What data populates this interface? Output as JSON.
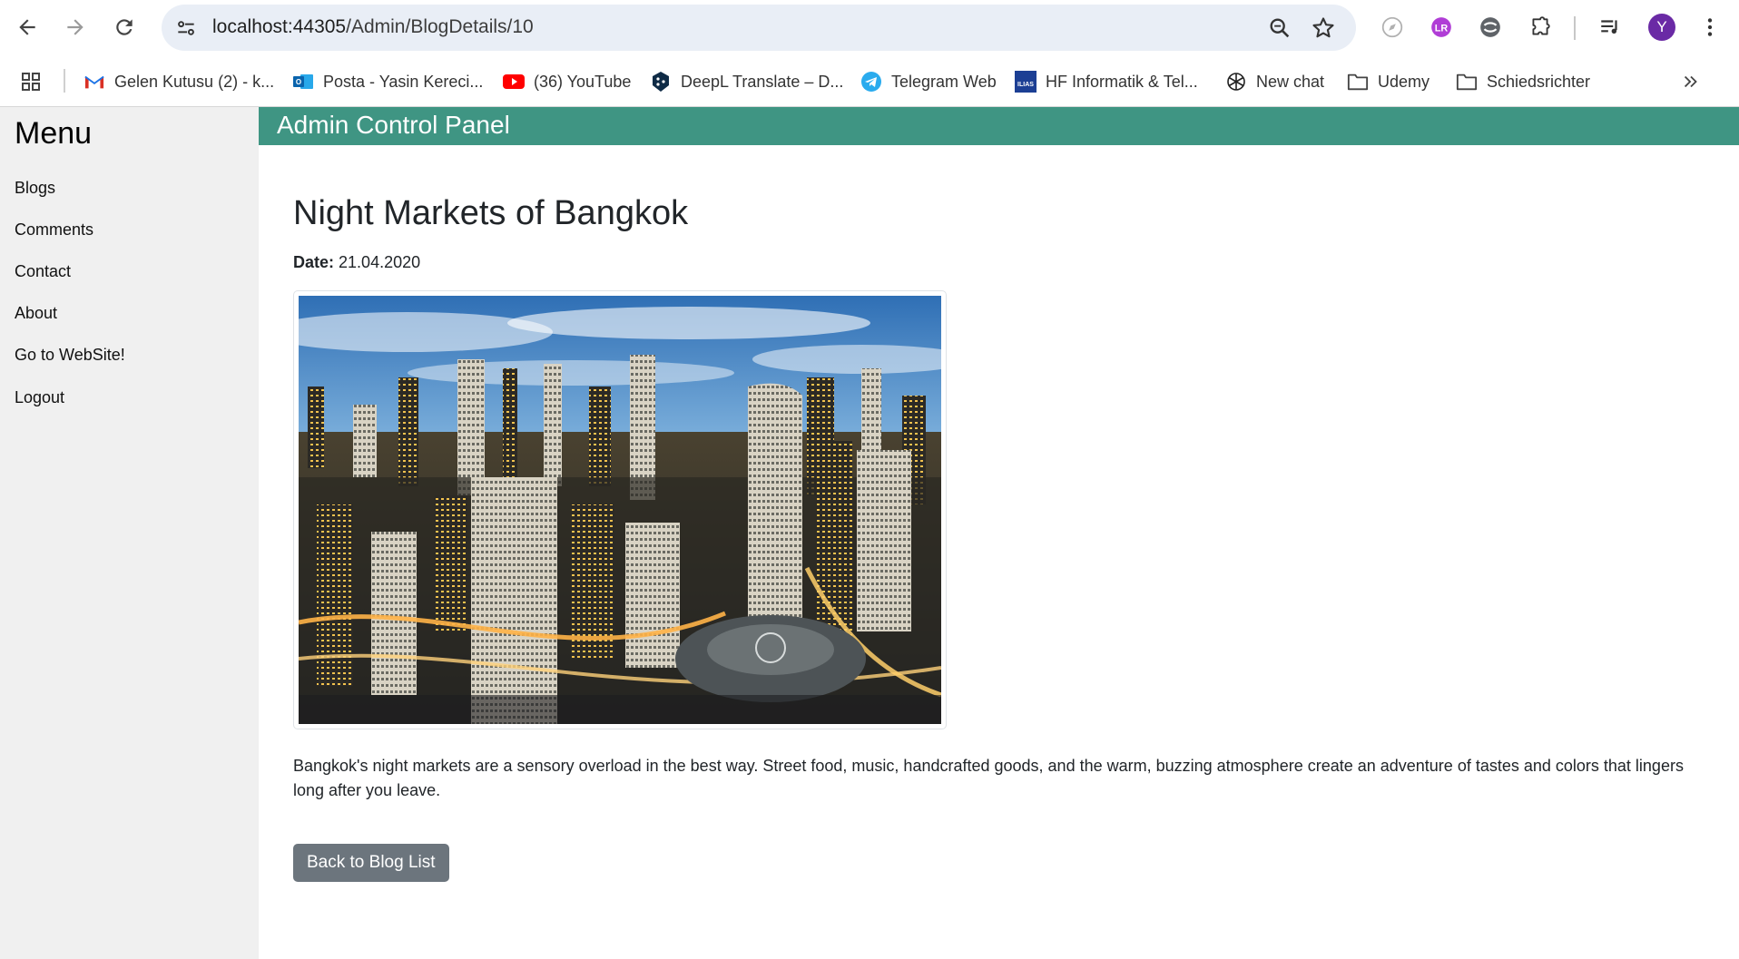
{
  "browser": {
    "url_host": "localhost:44305",
    "url_path": "/Admin/BlogDetails/10",
    "avatar_letter": "Y",
    "bookmarks": [
      {
        "label": "Gelen Kutusu (2) - k...",
        "icon": "gmail-icon"
      },
      {
        "label": "Posta - Yasin Kereci...",
        "icon": "outlook-icon"
      },
      {
        "label": "(36) YouTube",
        "icon": "youtube-icon"
      },
      {
        "label": "DeepL Translate – D...",
        "icon": "deepl-icon"
      },
      {
        "label": "Telegram Web",
        "icon": "telegram-icon"
      },
      {
        "label": "HF Informatik & Tel...",
        "icon": "ilias-icon"
      },
      {
        "label": "New chat",
        "icon": "openai-icon"
      },
      {
        "label": "Udemy",
        "icon": "folder-icon"
      },
      {
        "label": "Schiedsrichter",
        "icon": "folder-icon"
      }
    ],
    "colors": {
      "omnibox_bg": "#e9eef6",
      "avatar_bg": "#6a2aa5"
    }
  },
  "sidebar": {
    "title": "Menu",
    "items": [
      "Blogs",
      "Comments",
      "Contact",
      "About",
      "Go to WebSite!",
      "Logout"
    ]
  },
  "header": {
    "title": "Admin Control Panel",
    "color": "#3f9583"
  },
  "post": {
    "title": "Night Markets of Bangkok",
    "date_label": "Date:",
    "date": "21.04.2020",
    "image_subject": "aerial view of Bangkok city skyline at dusk",
    "body": "Bangkok's night markets are a sensory overload in the best way. Street food, music, handcrafted goods, and the warm, buzzing atmosphere create an adventure of tastes and colors that lingers long after you leave.",
    "back_button": "Back to Blog List",
    "back_button_color": "#6c757d"
  }
}
